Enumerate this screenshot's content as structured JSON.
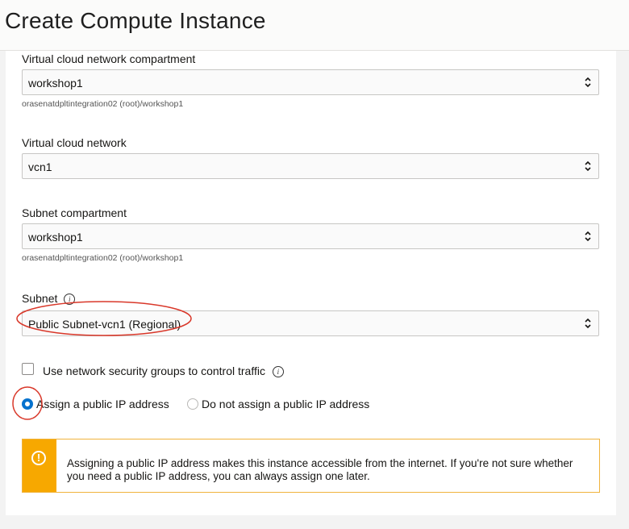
{
  "header": {
    "title": "Create Compute Instance"
  },
  "vcn_compartment": {
    "label": "Virtual cloud network compartment",
    "value": "workshop1",
    "hint": "orasenatdpltintegration02 (root)/workshop1"
  },
  "vcn": {
    "label": "Virtual cloud network",
    "value": "vcn1"
  },
  "subnet_compartment": {
    "label": "Subnet compartment",
    "value": "workshop1",
    "hint": "orasenatdpltintegration02 (root)/workshop1"
  },
  "subnet": {
    "label": "Subnet",
    "value": "Public Subnet-vcn1 (Regional)"
  },
  "nsg": {
    "label": "Use network security groups to control traffic",
    "checked": false
  },
  "public_ip": {
    "selected": "assign",
    "assign_label": "Assign a public IP address",
    "no_assign_label": "Do not assign a public IP address"
  },
  "warning": {
    "icon": "exclamation-icon",
    "text": "Assigning a public IP address makes this instance accessible from the internet. If you're not sure whether you need a public IP address, you can always assign one later."
  },
  "colors": {
    "accent": "#0572ce",
    "warning": "#f7a800",
    "annotation": "#d9382a"
  }
}
